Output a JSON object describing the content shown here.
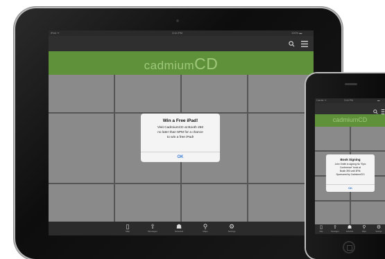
{
  "ipad": {
    "status": {
      "left": "iPad ᯤ",
      "time": "3:44 PM",
      "right": "100% ▬"
    },
    "brand": {
      "prefix": "cadmium",
      "suffix": "CD"
    },
    "icons": {
      "search": "search-icon",
      "menu": "menu-icon"
    },
    "dialog": {
      "title": "Win a Free iPad!",
      "body_lines": [
        "Visit CadmiumCD at Booth 250",
        "no later than 5PM for a chance",
        "to win a free iPad!"
      ],
      "ok": "OK"
    },
    "tabs": [
      {
        "icon": "▯",
        "label": "Map"
      },
      {
        "icon": "⇧",
        "label": "Messages"
      },
      {
        "icon": "☗",
        "label": "Schedule"
      },
      {
        "icon": "⚲",
        "label": "Maps"
      },
      {
        "icon": "⚙",
        "label": "Settings"
      }
    ]
  },
  "iphone": {
    "status": {
      "left": "Carrier ᯤ",
      "time": "3:44 PM",
      "right": "▬"
    },
    "brand": "cadmiumCD",
    "dialog": {
      "title": "Book Signing",
      "body_lines": [
        "John Smith is signing his \"Epic",
        "Conference\" book at",
        "Booth 390 until 3PM.",
        "Sponsored by CadmiumCD!"
      ],
      "ok": "OK"
    },
    "tabs": [
      {
        "icon": "▯",
        "label": "Map"
      },
      {
        "icon": "⇧",
        "label": "Messages"
      },
      {
        "icon": "☗",
        "label": "Schedule"
      },
      {
        "icon": "⚲",
        "label": "Maps"
      },
      {
        "icon": "⚙",
        "label": "Settings"
      }
    ]
  },
  "colors": {
    "brand_green": "#5f913a",
    "ok_blue": "#3a7bd5"
  }
}
